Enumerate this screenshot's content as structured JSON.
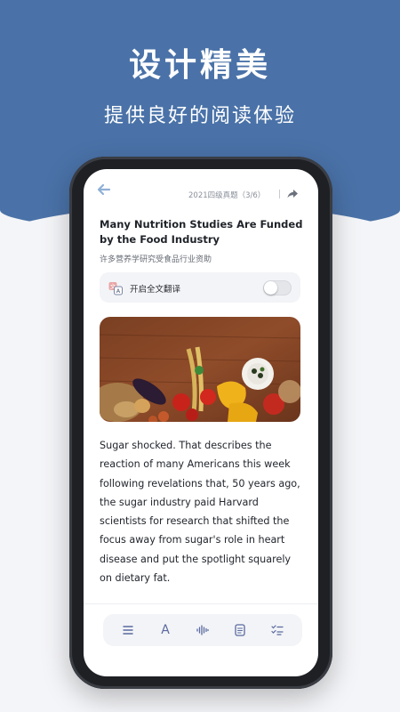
{
  "promo": {
    "headline": "设计精美",
    "subline": "提供良好的阅读体验"
  },
  "header": {
    "exam_label": "2021四级真题（3/6）"
  },
  "article": {
    "title": "Many Nutrition Studies Are Funded by the Food Industry",
    "subtitle": "许多营养学研究受食品行业资助",
    "body": "Sugar shocked. That describes the reaction of many Americans this week following revelations that, 50 years ago, the sugar industry paid Harvard scientists for research that shifted the focus away from sugar's role in heart disease and put the spotlight squarely on dietary fat."
  },
  "translate": {
    "label": "开启全文翻译",
    "enabled": false
  },
  "toolbar": {
    "font_label": "A",
    "items": [
      "menu-icon",
      "font-size-icon",
      "audio-icon",
      "notes-icon",
      "checklist-icon"
    ]
  },
  "colors": {
    "brand": "#4a72a8",
    "icon": "#5a6aa0"
  }
}
